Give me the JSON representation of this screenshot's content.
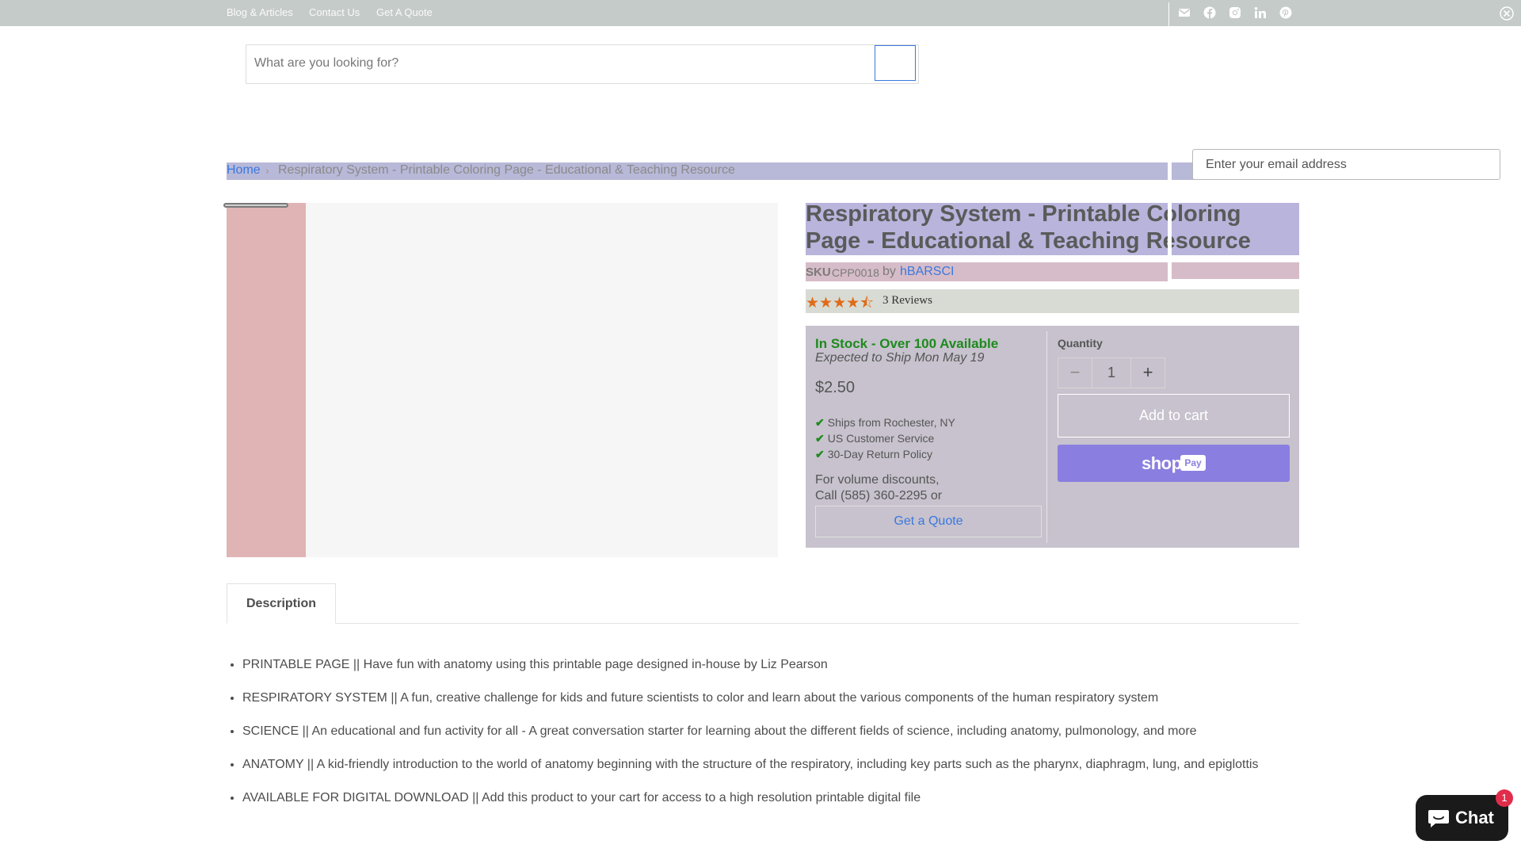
{
  "topbar": {
    "links": [
      "Blog & Articles",
      "Contact Us",
      "Get A Quote"
    ],
    "social_icons": [
      "email-icon",
      "facebook-icon",
      "instagram-icon",
      "linkedin-icon",
      "pinterest-icon"
    ]
  },
  "search": {
    "placeholder": "What are you looking for?"
  },
  "newsletter": {
    "placeholder": "Enter your email address"
  },
  "breadcrumb": {
    "home": "Home",
    "separator": "›",
    "current": "Respiratory System - Printable Coloring Page - Educational & Teaching Resource"
  },
  "product": {
    "title": "Respiratory System - Printable Coloring Page - Educational & Teaching Resource",
    "sku_label": "SKU",
    "sku": "CPP0018",
    "by": "by",
    "vendor": "hBARSCI",
    "rating": 4.5,
    "stars": "★★★★⯪",
    "reviews": "3 Reviews",
    "stock": "In Stock - Over 100 Available",
    "ship_date": "Expected to Ship Mon May 19",
    "price": "$2.50",
    "features": [
      "Ships from Rochester, NY",
      "US Customer Service",
      "30-Day Return Policy"
    ],
    "volume_line1": "For volume discounts,",
    "volume_line2": "Call (585) 360-2295 or",
    "quote_button": "Get a Quote",
    "quantity_label": "Quantity",
    "quantity": "1",
    "minus": "−",
    "plus": "+",
    "add_to_cart": "Add to cart",
    "shoppay_label": "shop",
    "shoppay_badge": "Pay"
  },
  "tabs": {
    "description": "Description"
  },
  "description": [
    "PRINTABLE PAGE || Have fun with anatomy using this printable page designed in-house by Liz Pearson",
    "RESPIRATORY SYSTEM || A fun, creative challenge for kids and future scientists to color and learn about the various components of the human respiratory system",
    "SCIENCE || An educational and fun activity for all - A great conversation starter for learning about the different fields of science, including anatomy, pulmonology, and more",
    "ANATOMY || A kid-friendly introduction to the world of anatomy beginning with the structure of the respiratory, including key parts such as the pharynx, diaphragm, lung, and epiglottis",
    "AVAILABLE FOR DIGITAL DOWNLOAD || Add this product to your cart for access to a high resolution printable digital file"
  ],
  "chat": {
    "label": "Chat",
    "badge": "1"
  },
  "colors": {
    "link": "#3a78e0",
    "stock": "#1e8a1e",
    "star": "#e06b18",
    "shoppay": "#8a7ee0",
    "chat_badge": "#e12c4b"
  }
}
